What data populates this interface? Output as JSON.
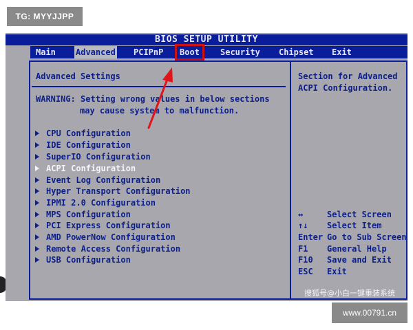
{
  "watermarks": {
    "top": "TG: MYYJJPP",
    "bottom": "www.00791.cn",
    "caption": "搜狐号@小白一键重装系统"
  },
  "bios": {
    "title": "BIOS SETUP UTILITY",
    "menu": [
      {
        "label": "Main"
      },
      {
        "label": "Advanced",
        "active": true
      },
      {
        "label": "PCIPnP"
      },
      {
        "label": "Boot",
        "highlighted": true
      },
      {
        "label": "Security"
      },
      {
        "label": "Chipset"
      },
      {
        "label": "Exit"
      }
    ],
    "panel": {
      "heading": "Advanced Settings",
      "warning_line1": "WARNING: Setting wrong values in below sections",
      "warning_line2": "may cause system to malfunction.",
      "entries": [
        {
          "label": "CPU Configuration"
        },
        {
          "label": "IDE Configuration"
        },
        {
          "label": "SuperIO Configuration"
        },
        {
          "label": "ACPI Configuration",
          "selected": true
        },
        {
          "label": "Event Log Configuration"
        },
        {
          "label": "Hyper Transport Configuration"
        },
        {
          "label": "IPMI 2.0 Configuration"
        },
        {
          "label": "MPS Configuration"
        },
        {
          "label": "PCI Express Configuration"
        },
        {
          "label": "AMD PowerNow Configuration"
        },
        {
          "label": "Remote Access Configuration"
        },
        {
          "label": "USB Configuration"
        }
      ]
    },
    "help": {
      "line1": "Section for Advanced",
      "line2": "ACPI Configuration.",
      "keys": [
        {
          "key": "↔",
          "desc": "Select Screen"
        },
        {
          "key": "↑↓",
          "desc": "Select Item"
        },
        {
          "key": "Enter",
          "desc": "Go to Sub Screen"
        },
        {
          "key": "F1",
          "desc": "General Help"
        },
        {
          "key": "F10",
          "desc": "Save and Exit"
        },
        {
          "key": "ESC",
          "desc": "Exit"
        }
      ]
    },
    "colors": {
      "background": "#a7a7ad",
      "blue": "#0a1e9c",
      "highlight_box": "#d01010"
    }
  }
}
